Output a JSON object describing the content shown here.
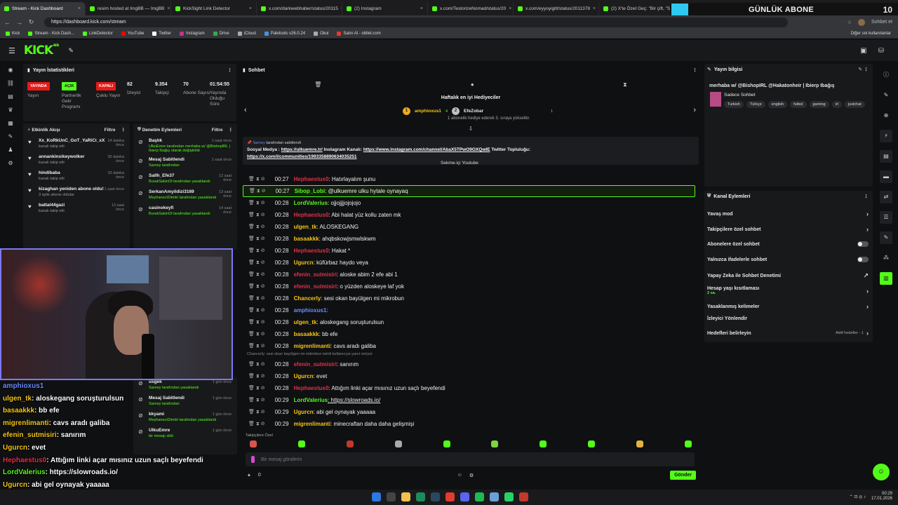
{
  "browser": {
    "tabs": [
      {
        "label": "Stream - Kick Dashboard",
        "active": true
      },
      {
        "label": "resim hosted at ImgBB — ImgBB"
      },
      {
        "label": "KickSight Link Detector"
      },
      {
        "label": "x.com/darkwebhaber/status/20115"
      },
      {
        "label": "(2) Instagram"
      },
      {
        "label": "x.com/TestorizeNomad/status/20"
      },
      {
        "label": "x.com/eyyoyigitt/status/2011378"
      },
      {
        "label": "(2) X'te Özet Geç: \"Bir çift, \"Squid"
      }
    ],
    "url": "https://dashboard.kick.com/stream",
    "profile_label": "Sohbet et",
    "bookmarks": [
      "Kick",
      "Stream - Kick Dash...",
      "LinkDetector",
      "YouTube",
      "Twitter",
      "Instagram",
      "Drive",
      "iCloud",
      "Paletools v26.0.24",
      "Okul",
      "Satın Al - obilet.com"
    ],
    "bookmarks_right": "Diğer sık kullanılanlar"
  },
  "overlay_banner": {
    "text": "GÜNLÜK ABONE",
    "count": "10",
    "accent": "#2ec8f0"
  },
  "kick": {
    "logo": "KICK",
    "beta": "BETA",
    "accent": "#53fc18"
  },
  "stats": {
    "title": "Yayın İstatistikleri",
    "items": [
      {
        "pill": "YAYINDA",
        "pill_color": "#e91916",
        "label": "Yayın"
      },
      {
        "pill": "AÇIK",
        "pill_color": "#53fc18",
        "label": "Partnerlik Gelir Programı"
      },
      {
        "pill": "KAPALI",
        "pill_color": "#e91916",
        "label": "Çoklu Yayın"
      },
      {
        "value": "82",
        "label": "İzleyici"
      },
      {
        "value": "9.354",
        "label": "Takipçi"
      },
      {
        "value": "70",
        "label": "Abone Sayısı"
      },
      {
        "value": "01:54:55",
        "label": "Yayında Olduğu Süre"
      }
    ]
  },
  "activity": {
    "title": "Etkinlik Akışı",
    "filter": "Filtre",
    "items": [
      {
        "name": "Xx_KoRkUnC_GoT_YaRiCi_xX",
        "sub": "kanalı takip etti",
        "time": "24 dakika önce"
      },
      {
        "name": "annankinsikeywolker",
        "sub": "kanalı takip etti",
        "time": "30 dakika önce"
      },
      {
        "name": "hindibaba",
        "sub": "kanalı takip etti",
        "time": "33 dakika önce"
      },
      {
        "name": "kizaghan yeniden abone oldu!",
        "sub": "3 aylık abone oldular",
        "time": "1 saat önce"
      },
      {
        "name": "battal44gazi",
        "sub": "kanalı takip etti",
        "time": "13 saat önce"
      }
    ]
  },
  "moderation": {
    "title": "Denetim Eylemleri",
    "filter": "Filtre",
    "items": [
      {
        "name": "Başlık",
        "sub": "UlkuEmre tarafından merhaba w/ @BishopIRL | Ibierp Ibağış olarak değiştirildi",
        "time": "1 saat önce"
      },
      {
        "name": "Mesaj Sabitlendi",
        "sub": "Sarney tarafından",
        "time": "1 saat önce"
      },
      {
        "name": "Sallh_Efe37",
        "sub": "BurakSakinOl tarafından yasaklandı",
        "time": "12 saat önce"
      },
      {
        "name": "SerkanAmyildizi3169",
        "sub": "MeyhaneciDimitri tarafından yasaklandı",
        "time": "13 saat önce"
      },
      {
        "name": "casinokeyfi",
        "sub": "BurakSakinOl tarafından yasaklandı",
        "time": "14 saat önce"
      }
    ],
    "items_lower": [
      {
        "name": "usgek",
        "sub": "Sarney tarafından yasaklandı",
        "time": "1 gün önce"
      },
      {
        "name": "Mesaj Sabitlendi",
        "sub": "Sarney tarafından",
        "time": "1 gün önce"
      },
      {
        "name": "kkyami",
        "sub": "MeyhaneciDimitri tarafından yasaklandı",
        "time": "1 gün önce"
      },
      {
        "name": "UlkuEmre",
        "sub": "bir mesajı sildi",
        "time": "1 gün önce"
      }
    ]
  },
  "overlay_chat": [
    {
      "user": "amphioxus1",
      "text": "",
      "color": "#6a8cff"
    },
    {
      "user": "ulgen_tk",
      "text": ": aloskegang soruşturulsun",
      "color": "#f5c518"
    },
    {
      "user": "basaakkk",
      "text": ": bb efe",
      "color": "#f5c518"
    },
    {
      "user": "migrenlimanti",
      "text": ": cavs aradı galiba",
      "color": "#f5c518"
    },
    {
      "user": "efenin_sutmisiri",
      "text": ": sanırım",
      "color": "#f5c518"
    },
    {
      "user": "Ugurcn",
      "text": ": evet",
      "color": "#f5c518"
    },
    {
      "user": "Hephaestus0",
      "text": ": Attığım linki açar mısınız uzun saçlı beyefendi",
      "color": "#e0304a"
    },
    {
      "user": "LordValerius",
      "text": ": https://slowroads.io/",
      "color": "#53fc18"
    },
    {
      "user": "Ugurcn",
      "text": ": abi gel oynayak yaaaaa",
      "color": "#f5c518"
    },
    {
      "user": "migrenlimanti",
      "text": ": minecraftan daha daha gelişmişi",
      "color": "#f5c518"
    }
  ],
  "chat": {
    "title": "Sohbet",
    "gifters_title": "Haftalık en iyi Hediyeciler",
    "gifter1": "amphioxus1",
    "gifter1_count": "4",
    "gifter2": "EfeZobar",
    "gifter2_count": "1",
    "gift_note": "1 abonelik hediye ederek 3. sıraya yükseltin",
    "pinned_by_user": "Sarney",
    "pinned_by": "tarafından sabitlendi",
    "pinned_text_1": "Sosyal Medya : ",
    "pinned_link_1": "https://ulkuemre.tr/",
    "pinned_text_2": " Instagram Kanalı: ",
    "pinned_link_2": "https://www.instagram.com/channel/AbaX5TPwO9OXQwIE",
    "pinned_text_3": " Twitter Topluluğu:",
    "pinned_link_3": "https://x.com/i/communities/1993358890634035251",
    "yt_tag": "Sekme-içi Youtube",
    "messages": [
      {
        "time": "00:27",
        "user": "Hephaestus0",
        "color": "#e0304a",
        "text": ": Hatırlayalım şunu"
      },
      {
        "time": "00:27",
        "user": "Sibop_Lobi",
        "color": "#53fc18",
        "text": ": @ulkuemre ulku hytale oynayaq",
        "highlight": true
      },
      {
        "time": "00:28",
        "user": "LordValerius",
        "color": "#53fc18",
        "text": ": ojjojjjjojojojo"
      },
      {
        "time": "00:28",
        "user": "Hephaestus0",
        "color": "#e0304a",
        "text": ": Abi halat yüz kollu zaten mk"
      },
      {
        "time": "00:28",
        "user": "ulgen_tk",
        "color": "#f5c518",
        "text": ": ALOSKEGANG"
      },
      {
        "time": "00:28",
        "user": "basaakkk",
        "color": "#f5c518",
        "text": ": ahqbskowjsmwlskwm"
      },
      {
        "time": "00:28",
        "user": "Hephaestus0",
        "color": "#e0304a",
        "text": ": Hakat *"
      },
      {
        "time": "00:28",
        "user": "Ugurcn",
        "color": "#f5c518",
        "text": ": küfürbaz haydo veya"
      },
      {
        "time": "00:28",
        "user": "efenin_sutmisiri",
        "color": "#e0304a",
        "text": ": aloske abim 2 efe abi 1"
      },
      {
        "time": "00:28",
        "user": "efenin_sutmisiri",
        "color": "#e0304a",
        "text": ": o yüzden aloskeye laf yok"
      },
      {
        "time": "00:28",
        "user": "Chancerly",
        "color": "#f5c518",
        "text": ": sesi okan bayülgen mi mikrobun"
      },
      {
        "time": "00:28",
        "user": "amphioxus1",
        "color": "#6a8cff",
        "text": ":"
      },
      {
        "time": "00:28",
        "user": "ulgen_tk",
        "color": "#f5c518",
        "text": ": aloskegang soruşturulsun"
      },
      {
        "time": "00:28",
        "user": "basaakkk",
        "color": "#f5c518",
        "text": ": bb efe"
      },
      {
        "time": "00:28",
        "user": "migrenlimanti",
        "color": "#f5c518",
        "text": ": cavs aradı galiba"
      },
      {
        "reply": "Chancerly: sesi okan bayülgen mi mikrobun isimli kullanıcıya yanıt veriyor"
      },
      {
        "time": "00:28",
        "user": "efenin_sutmisiri",
        "color": "#e0304a",
        "text": ": sanırım"
      },
      {
        "time": "00:28",
        "user": "Ugurcn",
        "color": "#f5c518",
        "text": ": evet"
      },
      {
        "time": "00:28",
        "user": "Hephaestus0",
        "color": "#e0304a",
        "text": ": Attığım linki açar mısınız uzun saçlı beyefendi"
      },
      {
        "time": "00:29",
        "user": "LordValerius",
        "color": "#53fc18",
        "text": ": https://slowroads.io/",
        "link": true
      },
      {
        "time": "00:29",
        "user": "Ugurcn",
        "color": "#f5c518",
        "text": ": abi gel oynayak yaaaaa"
      },
      {
        "time": "00:29",
        "user": "migrenlimanti",
        "color": "#f5c518",
        "text": ": minecraftan daha daha gelişmişi"
      }
    ],
    "followers_only": "Takipçilere Özel",
    "input_placeholder": "Bir mesaj gönderin",
    "points": "0",
    "send": "Gönder"
  },
  "info": {
    "title": "Yayın bilgisi",
    "stream_title": "merhaba w/ @BishopIRL @Hakatonheir | Ibierp Ibağış",
    "category": "Sadece Sohbet",
    "tags": [
      "Turkish",
      "Türkçe",
      "english",
      "futbol",
      "gaming",
      "irl",
      "justchat"
    ]
  },
  "channel_actions": {
    "title": "Kanal Eylemleri",
    "items": [
      {
        "label": "Yavaş mod",
        "kind": "chevron"
      },
      {
        "label": "Takipçilere özel sohbet",
        "kind": "chevron"
      },
      {
        "label": "Abonelere özel sohbet",
        "kind": "toggle"
      },
      {
        "label": "Yalnızca ifadelerle sohbet",
        "kind": "toggle"
      },
      {
        "label": "Yapay Zeka ile Sohbet Denetimi",
        "kind": "external"
      },
      {
        "label": "Hesap yaşı kısıtlaması",
        "sub": "2 sa.",
        "kind": "chevron"
      },
      {
        "label": "Yasaklanmış kelimeler",
        "kind": "chevron"
      },
      {
        "label": "İzleyici Yönlendir",
        "kind": "none"
      },
      {
        "label": "Hedefleri belirleyin",
        "sub_right": "Aktif hedefler - 1",
        "kind": "chevron"
      }
    ]
  },
  "taskbar": {
    "time": "00:29",
    "date": "17.01.2026"
  }
}
